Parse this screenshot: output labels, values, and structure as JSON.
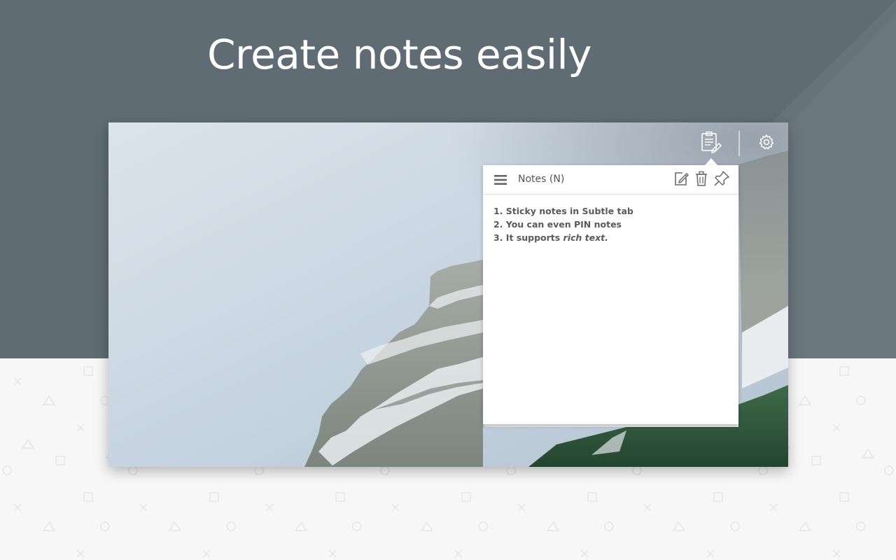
{
  "headline": "Create notes easily",
  "colors": {
    "top_band": "#5f6c74",
    "bottom_background": "#f7f7f7",
    "panel_background": "#ffffff",
    "icon": "#6b6b6b"
  },
  "screen": {
    "icons": {
      "notes_toggle": "clipboard-pencil-icon",
      "settings": "gear-icon"
    }
  },
  "notes_panel": {
    "title": "Notes (N)",
    "header_icons": [
      "menu-icon",
      "new-note-icon",
      "trash-icon",
      "pin-icon"
    ],
    "lines": [
      {
        "text": "1. Sticky notes in Subtle tab"
      },
      {
        "text": "2. You can even PIN notes"
      },
      {
        "prefix": "3. It supports ",
        "italic": "rich text."
      }
    ]
  }
}
